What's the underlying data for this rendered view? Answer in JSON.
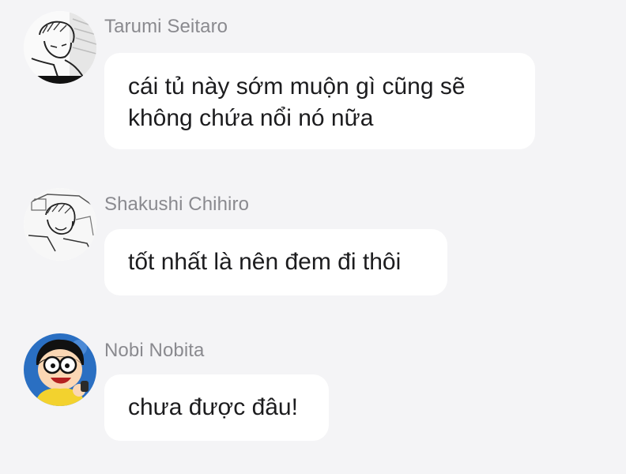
{
  "messages": [
    {
      "sender": "Tarumi Seitaro",
      "avatar_icon": "manga-character-white-hair-avatar",
      "lines": [
        "cái tủ này sớm muộn gì cũng sẽ",
        "không chứa nổi nó nữa"
      ]
    },
    {
      "sender": "Shakushi Chihiro",
      "avatar_icon": "manga-character-sketch-avatar",
      "lines": [
        "tốt nhất là nên đem đi thôi"
      ]
    },
    {
      "sender": "Nobi Nobita",
      "avatar_icon": "cartoon-boy-glasses-avatar",
      "lines": [
        "chưa được đâu!"
      ]
    }
  ],
  "colors": {
    "background": "#f4f4f6",
    "bubble": "#ffffff",
    "sender_name": "#8a8a8f",
    "message_text": "#1c1c1e",
    "nobita_avatar_bg": "#2a6fc2"
  }
}
